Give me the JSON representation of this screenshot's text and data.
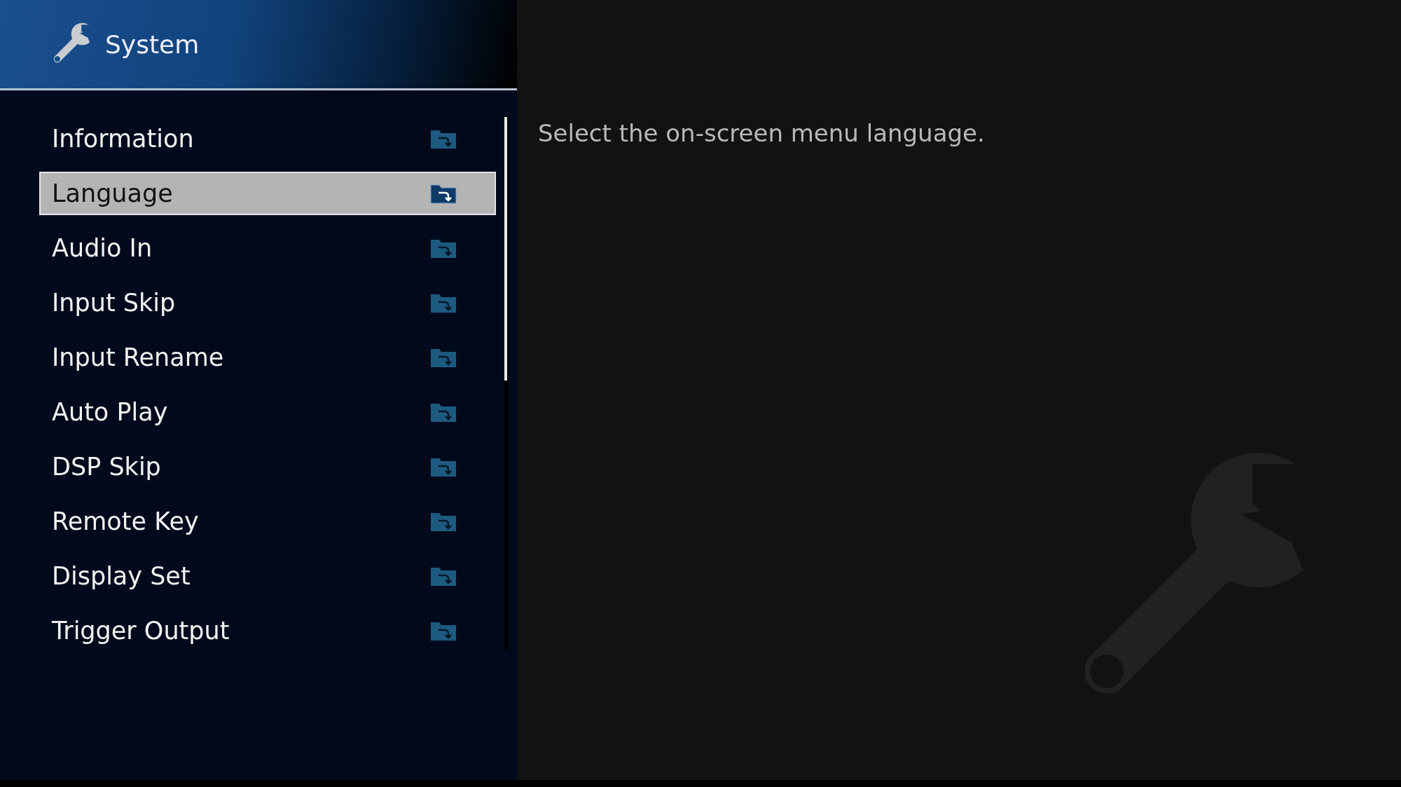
{
  "header": {
    "title": "System"
  },
  "menu": {
    "items": [
      {
        "label": "Information",
        "selected": false
      },
      {
        "label": "Language",
        "selected": true
      },
      {
        "label": "Audio In",
        "selected": false
      },
      {
        "label": "Input Skip",
        "selected": false
      },
      {
        "label": "Input Rename",
        "selected": false
      },
      {
        "label": "Auto Play",
        "selected": false
      },
      {
        "label": "DSP Skip",
        "selected": false
      },
      {
        "label": "Remote Key",
        "selected": false
      },
      {
        "label": "Display Set",
        "selected": false
      },
      {
        "label": "Trigger Output",
        "selected": false
      }
    ]
  },
  "description": "Select the on-screen menu language."
}
